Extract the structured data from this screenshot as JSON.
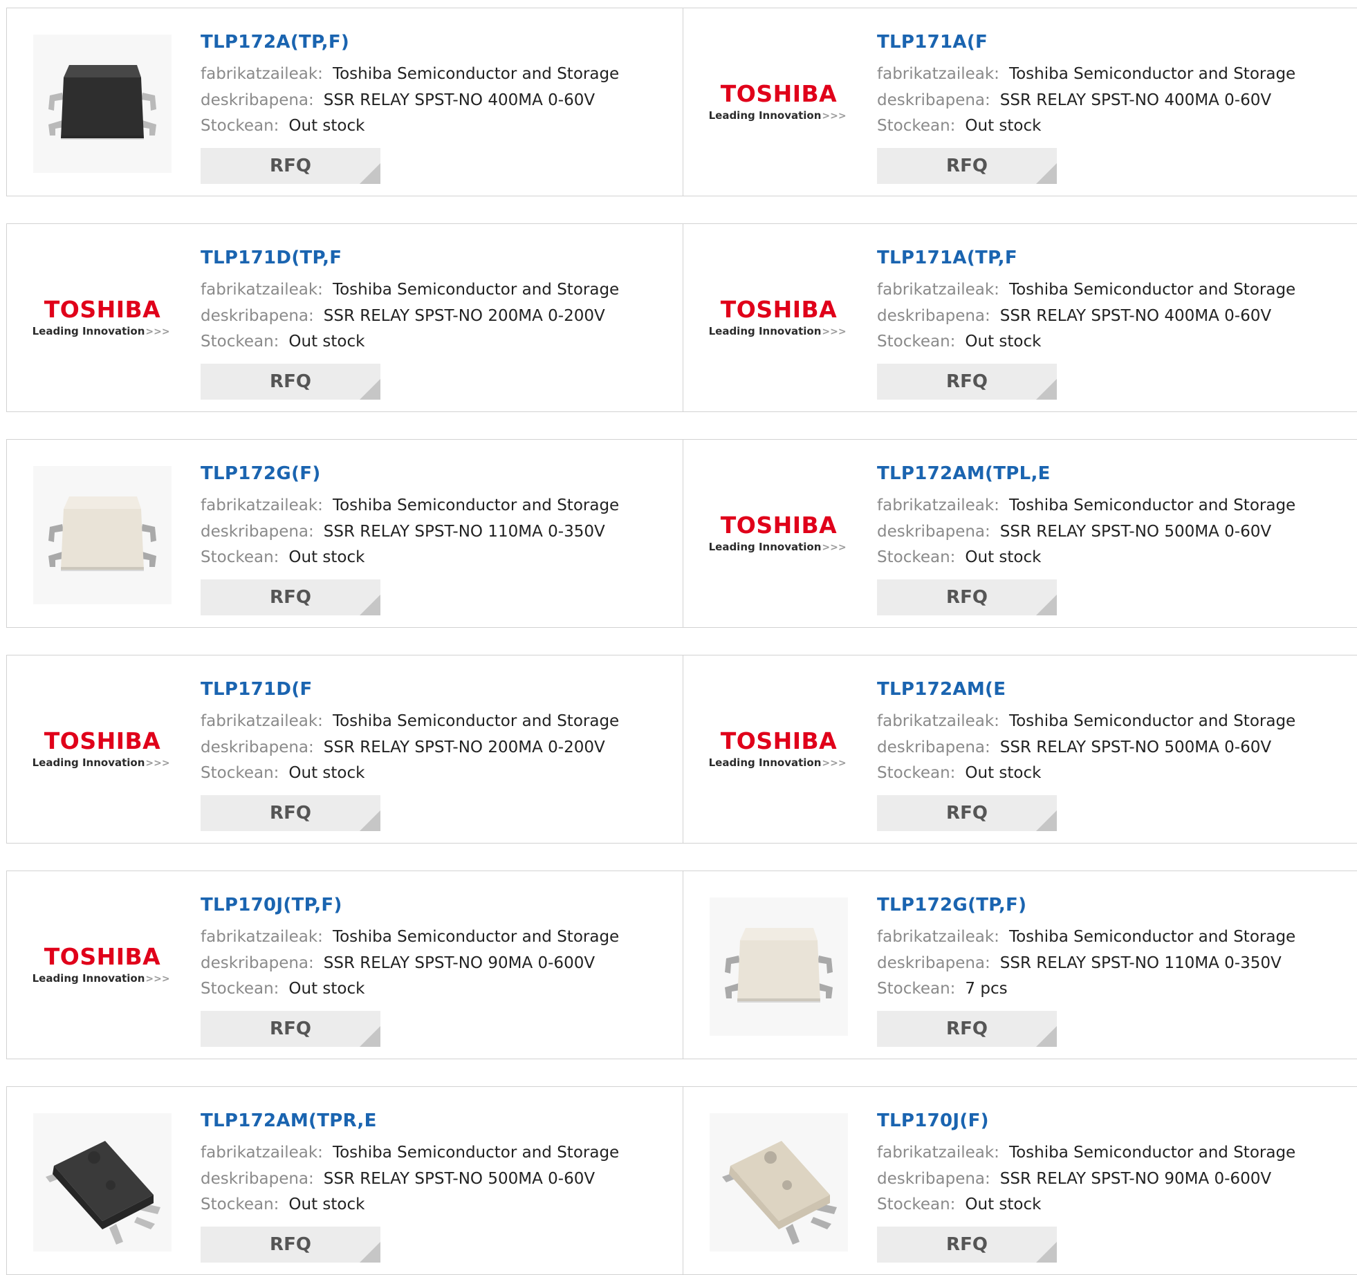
{
  "labels": {
    "manufacturer": "fabrikatzaileak:",
    "description": "deskribapena:",
    "stock": "Stockean:",
    "rfq": "RFQ"
  },
  "logo": {
    "brand": "TOSHIBA",
    "tagline": "Leading Innovation >>>"
  },
  "colors": {
    "link": "#1a64b0",
    "brand_red": "#e0001a",
    "rfq_bg": "#ececec"
  },
  "products": [
    {
      "name": "TLP172A(TP,F)",
      "manufacturer": "Toshiba Semiconductor and Storage",
      "description": "SSR RELAY SPST-NO 400MA 0-60V",
      "stock": "Out stock",
      "image": "chip-black-photo"
    },
    {
      "name": "TLP171A(F",
      "manufacturer": "Toshiba Semiconductor and Storage",
      "description": "SSR RELAY SPST-NO 400MA 0-60V",
      "stock": "Out stock",
      "image": "toshiba-logo"
    },
    {
      "name": "TLP171D(TP,F",
      "manufacturer": "Toshiba Semiconductor and Storage",
      "description": "SSR RELAY SPST-NO 200MA 0-200V",
      "stock": "Out stock",
      "image": "toshiba-logo"
    },
    {
      "name": "TLP171A(TP,F",
      "manufacturer": "Toshiba Semiconductor and Storage",
      "description": "SSR RELAY SPST-NO 400MA 0-60V",
      "stock": "Out stock",
      "image": "toshiba-logo"
    },
    {
      "name": "TLP172G(F)",
      "manufacturer": "Toshiba Semiconductor and Storage",
      "description": "SSR RELAY SPST-NO 110MA 0-350V",
      "stock": "Out stock",
      "image": "chip-white-photo"
    },
    {
      "name": "TLP172AM(TPL,E",
      "manufacturer": "Toshiba Semiconductor and Storage",
      "description": "SSR RELAY SPST-NO 500MA 0-60V",
      "stock": "Out stock",
      "image": "toshiba-logo"
    },
    {
      "name": "TLP171D(F",
      "manufacturer": "Toshiba Semiconductor and Storage",
      "description": "SSR RELAY SPST-NO 200MA 0-200V",
      "stock": "Out stock",
      "image": "toshiba-logo"
    },
    {
      "name": "TLP172AM(E",
      "manufacturer": "Toshiba Semiconductor and Storage",
      "description": "SSR RELAY SPST-NO 500MA 0-60V",
      "stock": "Out stock",
      "image": "toshiba-logo"
    },
    {
      "name": "TLP170J(TP,F)",
      "manufacturer": "Toshiba Semiconductor and Storage",
      "description": "SSR RELAY SPST-NO 90MA 0-600V",
      "stock": "Out stock",
      "image": "toshiba-logo"
    },
    {
      "name": "TLP172G(TP,F)",
      "manufacturer": "Toshiba Semiconductor and Storage",
      "description": "SSR RELAY SPST-NO 110MA 0-350V",
      "stock": "7 pcs",
      "image": "chip-white-photo"
    },
    {
      "name": "TLP172AM(TPR,E",
      "manufacturer": "Toshiba Semiconductor and Storage",
      "description": "SSR RELAY SPST-NO 500MA 0-60V",
      "stock": "Out stock",
      "image": "chip-black-angled-photo"
    },
    {
      "name": "TLP170J(F)",
      "manufacturer": "Toshiba Semiconductor and Storage",
      "description": "SSR RELAY SPST-NO 90MA 0-600V",
      "stock": "Out stock",
      "image": "chip-beige-angled-photo"
    }
  ]
}
